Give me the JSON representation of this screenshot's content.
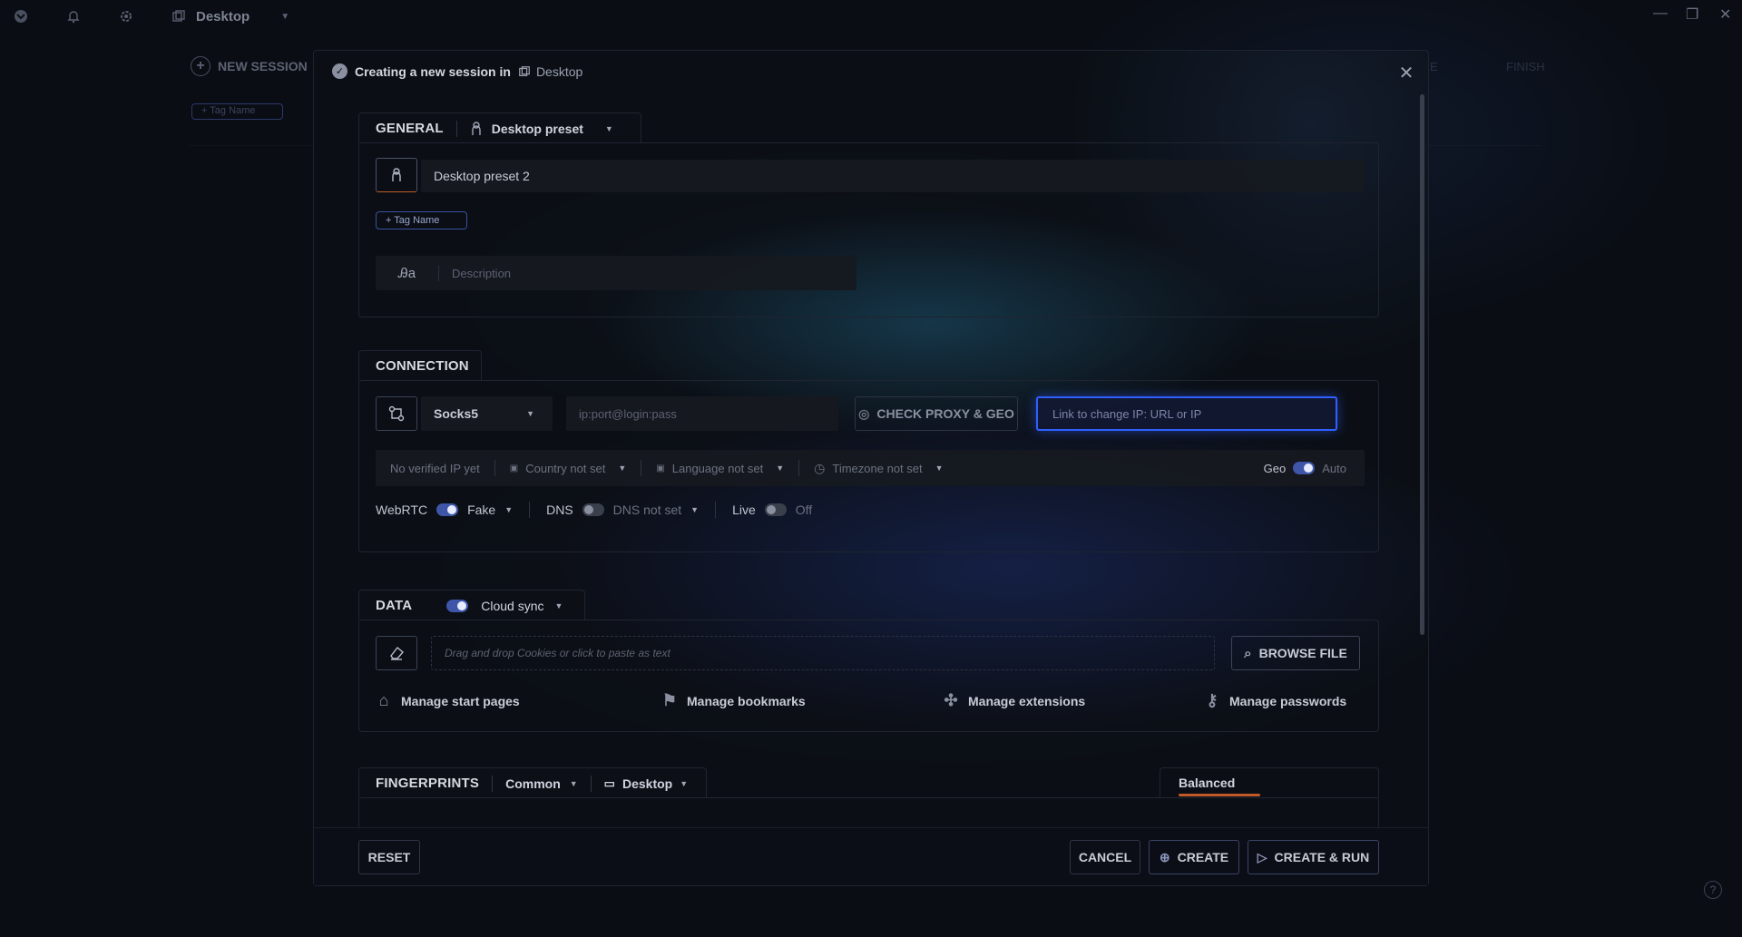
{
  "titlebar": {
    "workspace": "Desktop",
    "icons": [
      "app-logo-icon",
      "bell-icon",
      "gear-icon",
      "workspace-icon"
    ]
  },
  "background": {
    "new_session": "NEW SESSION",
    "tag_name": "+ Tag Name",
    "faint_right": "E",
    "faint_right2": "FINISH"
  },
  "modal": {
    "title": "Creating a new session in",
    "workspace": "Desktop",
    "general": {
      "title": "GENERAL",
      "preset_label": "Desktop preset",
      "name_value": "Desktop preset 2",
      "tag_button": "+ Tag Name",
      "description_placeholder": "Description"
    },
    "connection": {
      "title": "CONNECTION",
      "proxy_type": "Socks5",
      "proxy_placeholder": "ip:port@login:pass",
      "check_button": "CHECK PROXY & GEO",
      "change_ip_placeholder": "Link to change IP: URL or IP",
      "ip_status": "No verified IP yet",
      "country": "Country not set",
      "language": "Language not set",
      "timezone": "Timezone not set",
      "geo_label": "Geo",
      "geo_mode": "Auto",
      "webrtc_label": "WebRTC",
      "webrtc_mode": "Fake",
      "dns_label": "DNS",
      "dns_mode": "DNS not set",
      "live_label": "Live",
      "live_mode": "Off"
    },
    "data": {
      "title": "DATA",
      "sync_label": "Cloud sync",
      "cookies_placeholder": "Drag and drop Cookies or click to paste as text",
      "browse_button": "BROWSE FILE",
      "links": [
        {
          "label": "Manage start pages",
          "icon": "home-icon"
        },
        {
          "label": "Manage bookmarks",
          "icon": "bookmark-icon"
        },
        {
          "label": "Manage extensions",
          "icon": "puzzle-icon"
        },
        {
          "label": "Manage passwords",
          "icon": "key-icon"
        }
      ]
    },
    "fingerprints": {
      "title": "FINGERPRINTS",
      "mode": "Common",
      "device": "Desktop",
      "profile": "Balanced"
    },
    "footer": {
      "reset": "RESET",
      "cancel": "CANCEL",
      "create": "CREATE",
      "create_run": "CREATE & RUN"
    }
  },
  "colors": {
    "accent_blue": "#3f55a8",
    "active_border": "#2f5fff",
    "balanced_underline": "#c25a28"
  }
}
